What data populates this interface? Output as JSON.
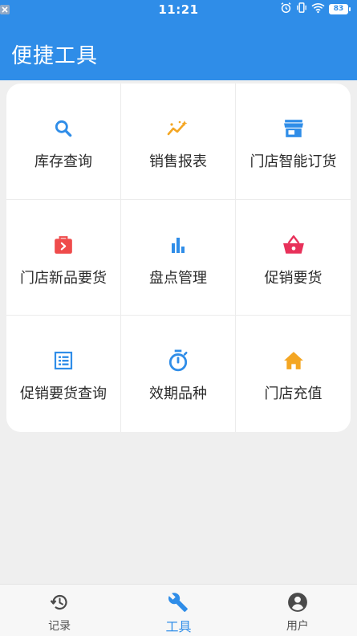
{
  "status_bar": {
    "time": "11:21",
    "battery": "83",
    "icons": [
      "close-icon",
      "alarm-icon",
      "vibrate-icon",
      "wifi-icon",
      "battery-icon"
    ]
  },
  "header": {
    "title": "便捷工具"
  },
  "tools": [
    {
      "label": "库存查询",
      "icon": "search-icon",
      "color": "#2f8de8"
    },
    {
      "label": "销售报表",
      "icon": "trend-sparkle-icon",
      "color": "#f4a623"
    },
    {
      "label": "门店智能订货",
      "icon": "store-icon",
      "color": "#2f8de8"
    },
    {
      "label": "门店新品要货",
      "icon": "suitcase-icon",
      "color": "#ef4b4b"
    },
    {
      "label": "盘点管理",
      "icon": "bar-chart-icon",
      "color": "#2f8de8"
    },
    {
      "label": "促销要货",
      "icon": "basket-icon",
      "color": "#e8315a"
    },
    {
      "label": "促销要货查询",
      "icon": "list-icon",
      "color": "#2f8de8"
    },
    {
      "label": "效期品种",
      "icon": "stopwatch-icon",
      "color": "#2f8de8"
    },
    {
      "label": "门店充值",
      "icon": "home-icon",
      "color": "#f4a623"
    }
  ],
  "bottom_nav": {
    "items": [
      {
        "label": "记录",
        "icon": "history-icon",
        "active": false
      },
      {
        "label": "工具",
        "icon": "wrench-icon",
        "active": true
      },
      {
        "label": "用户",
        "icon": "account-icon",
        "active": false
      }
    ]
  },
  "colors": {
    "primary": "#2f8de8",
    "orange": "#f4a623",
    "red": "#ef4b4b",
    "crimson": "#e8315a",
    "background": "#efefef"
  }
}
